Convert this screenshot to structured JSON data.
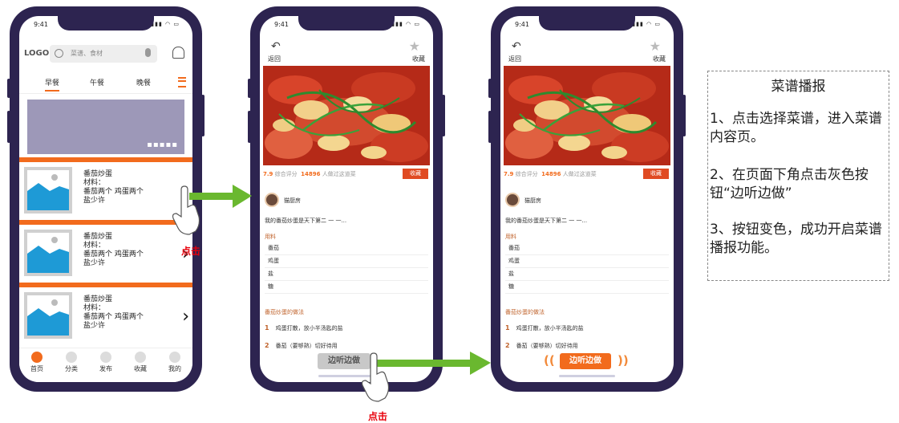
{
  "phone_home": {
    "time": "9:41",
    "logo": "LOGO",
    "search_placeholder": "菜谱、食材",
    "tabs": [
      "早餐",
      "午餐",
      "晚餐"
    ],
    "cards": [
      {
        "title": "番茄炒蛋",
        "line1": "材料：",
        "line2": "番茄两个 鸡蛋两个",
        "line3": "盐少许"
      },
      {
        "title": "番茄炒蛋",
        "line1": "材料：",
        "line2": "番茄两个 鸡蛋两个",
        "line3": "盐少许"
      },
      {
        "title": "番茄炒蛋",
        "line1": "材料：",
        "line2": "番茄两个 鸡蛋两个",
        "line3": "盐少许"
      }
    ],
    "tabbar": [
      "首页",
      "分类",
      "发布",
      "收藏",
      "我的"
    ]
  },
  "phone_detail": {
    "time": "9:41",
    "back": "返回",
    "favorite": "收藏",
    "rating": "7.9",
    "rating_label": "综合评分",
    "views": "14896",
    "views_label": "人做过这道菜",
    "collect_button": "收藏",
    "author": "猫厨房",
    "intro": "我的番茄炒蛋是天下第二 一 一...",
    "ingredients_title": "用料",
    "ingredients": [
      "番茄",
      "鸡蛋",
      "盐",
      "糖"
    ],
    "method_title": "番茄炒蛋的做法",
    "steps": [
      {
        "n": "1",
        "text": "鸡蛋打散，放小半汤匙的盐"
      },
      {
        "n": "2",
        "text": "番茄（要够熟）切好待用"
      }
    ],
    "listen_button": "边听边做"
  },
  "annotations": {
    "click_1": "点击",
    "click_2": "点击"
  },
  "note": {
    "title": "菜谱播报",
    "step1": "1、点击选择菜谱，进入菜谱内容页。",
    "step2": "2、在页面下角点击灰色按钮“边听边做”",
    "step3": "3、按钮变色，成功开启菜谱播报功能。"
  },
  "colors": {
    "phone_frame": "#2d2450",
    "accent": "#f26b1d",
    "arrow": "#6ab82f",
    "click_text": "#e8000b"
  }
}
